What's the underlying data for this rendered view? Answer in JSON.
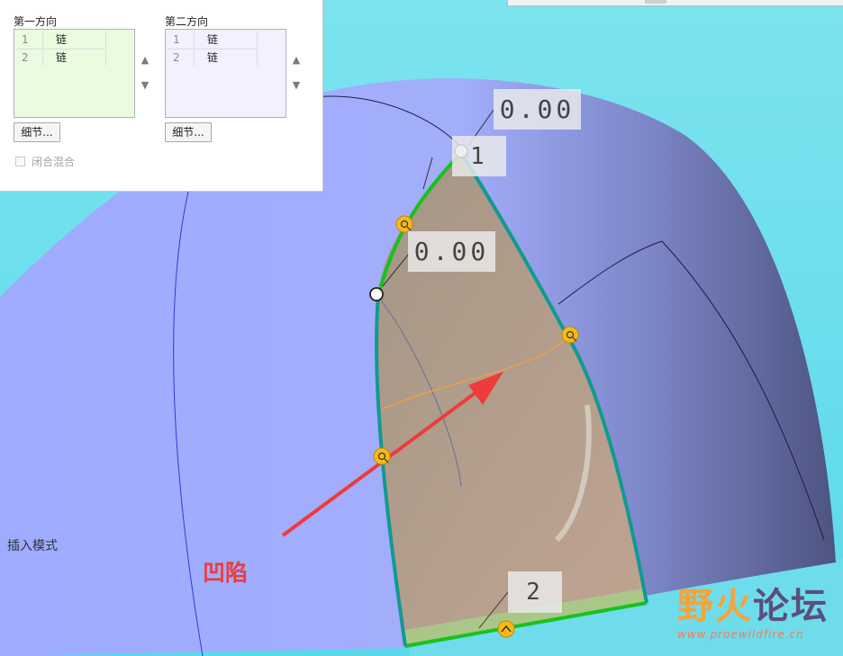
{
  "panel": {
    "first_direction": {
      "title": "第一方向",
      "rows": [
        {
          "index": "1",
          "type": "链"
        },
        {
          "index": "2",
          "type": "链"
        }
      ],
      "details_label": "细节..."
    },
    "second_direction": {
      "title": "第二方向",
      "rows": [
        {
          "index": "1",
          "type": "链"
        },
        {
          "index": "2",
          "type": "链"
        }
      ],
      "details_label": "细节..."
    },
    "closed_blend_label": "闭合混合",
    "closed_blend_checked": false
  },
  "viewport": {
    "dimensions": {
      "top_tip": "0.00",
      "tip_tag": "1",
      "left_upper": "0.00",
      "bottom_tag": "2"
    },
    "mode_text": "插入模式",
    "annotation": "凹陷"
  },
  "watermark": {
    "title_part1": "野火",
    "title_part2": "论坛",
    "url": "www.proewildfire.cn"
  },
  "colors": {
    "list_green": "#eafbe0",
    "list_purple": "#f3f0ff",
    "chain_green": "#18c21c",
    "chain_teal": "#119a8f",
    "arrow_red": "#ee3b3b",
    "handle_yellow": "#f7b917"
  }
}
